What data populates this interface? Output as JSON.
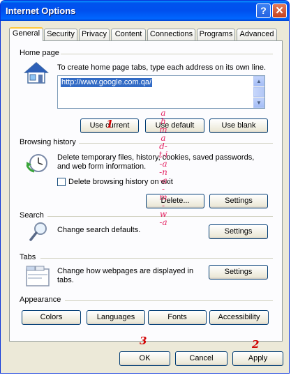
{
  "window": {
    "title": "Internet Options"
  },
  "titlebar": {
    "help_glyph": "?",
    "close_glyph": "✕"
  },
  "tabs": [
    {
      "label": "General",
      "active": true
    },
    {
      "label": "Security"
    },
    {
      "label": "Privacy"
    },
    {
      "label": "Content"
    },
    {
      "label": "Connections"
    },
    {
      "label": "Programs"
    },
    {
      "label": "Advanced"
    }
  ],
  "home_page": {
    "heading": "Home page",
    "description": "To create home page tabs, type each address on its own line.",
    "url": "http://www.google.com.qa/",
    "buttons": {
      "use_current": "Use current",
      "use_default": "Use default",
      "use_blank": "Use blank"
    },
    "icon": "house-icon"
  },
  "browsing_history": {
    "heading": "Browsing history",
    "description": "Delete temporary files, history, cookies, saved passwords, and web form information.",
    "checkbox_label": "Delete browsing history on exit",
    "checkbox_checked": false,
    "buttons": {
      "delete": "Delete...",
      "settings": "Settings"
    },
    "icon": "history-clock-icon"
  },
  "search": {
    "heading": "Search",
    "description": "Change search defaults.",
    "settings_label": "Settings",
    "icon": "magnifier-icon"
  },
  "tabs_section": {
    "heading": "Tabs",
    "description": "Change how webpages are displayed in tabs.",
    "settings_label": "Settings",
    "icon": "tabbed-window-icon"
  },
  "appearance": {
    "heading": "Appearance",
    "buttons": {
      "colors": "Colors",
      "languages": "Languages",
      "fonts": "Fonts",
      "accessibility": "Accessibility"
    }
  },
  "footer": {
    "ok": "OK",
    "cancel": "Cancel",
    "apply": "Apply"
  },
  "annotations": {
    "watermark": "ahmad-t-i-a-n-a-m-w-a",
    "marker_1": "1",
    "marker_2": "2",
    "marker_3": "3",
    "color": "#d10000"
  },
  "colors": {
    "titlebar": "#0054e3",
    "dialog_bg": "#ece9d8",
    "panel_bg": "#fcfcfe",
    "selection": "#316ac5",
    "active_tab_accent": "#ffc83c"
  }
}
